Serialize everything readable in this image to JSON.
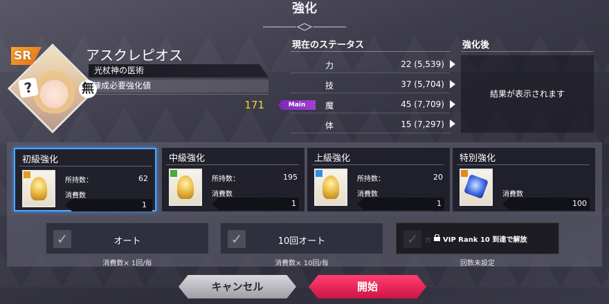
{
  "screen": {
    "title": "強化"
  },
  "character": {
    "rarity": "SR",
    "name": "アスクレピオス",
    "skill": "光杖神の医術",
    "attribute": "無",
    "required_label": "錬成必要強化値",
    "required_value": "171"
  },
  "status": {
    "header": "現在のステータス",
    "main_tag": "Main",
    "rows": [
      {
        "name": "力",
        "value": "22 (5,539)"
      },
      {
        "name": "技",
        "value": "37 (5,704)"
      },
      {
        "name": "魔",
        "value": "45 (7,709)"
      },
      {
        "name": "体",
        "value": "15 (7,297)"
      }
    ]
  },
  "after": {
    "header": "強化後",
    "message": "結果が表示されます"
  },
  "options": [
    {
      "name": "初級強化",
      "owned_label": "所持数：",
      "owned": "62",
      "cost_label": "消費数",
      "cost": "1",
      "selected": true,
      "stripe": "#e0a020"
    },
    {
      "name": "中級強化",
      "owned_label": "所持数：",
      "owned": "195",
      "cost_label": "消費数",
      "cost": "1",
      "selected": false,
      "stripe": "#4ea83a"
    },
    {
      "name": "上級強化",
      "owned_label": "所持数：",
      "owned": "20",
      "cost_label": "消費数",
      "cost": "1",
      "selected": false,
      "stripe": "#2f8ee0"
    },
    {
      "name": "特別強化",
      "cost_label": "消費数",
      "cost": "100",
      "selected": false,
      "stripe": "#e08a20"
    }
  ],
  "auto": [
    {
      "label": "オート",
      "sub": "消費数× 1回/毎"
    },
    {
      "label": "10回オート",
      "sub": "消費数× 10回/毎"
    },
    {
      "label": "VIP Rank 10 到達で解放",
      "faint": "カ　　　　　　　　　　　数変更",
      "sub": "回数未設定"
    }
  ],
  "buttons": {
    "cancel": "キャンセル",
    "start": "開始"
  }
}
